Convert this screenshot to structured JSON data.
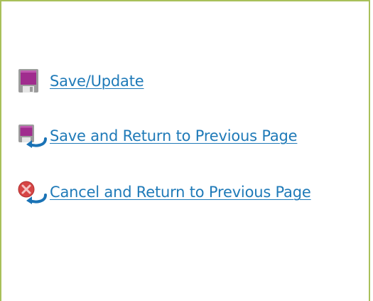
{
  "actions": [
    {
      "label": "Save/Update",
      "icon": "floppy-disk-icon"
    },
    {
      "label": "Save and Return to Previous Page",
      "icon": "floppy-disk-return-icon"
    },
    {
      "label": "Cancel and Return to Previous Page",
      "icon": "cancel-return-icon"
    }
  ],
  "colors": {
    "link": "#1f7ab8",
    "border": "#a9c05a",
    "floppy": "#a02c8e",
    "cancel": "#d64545",
    "return_arrow": "#1a73b6"
  }
}
